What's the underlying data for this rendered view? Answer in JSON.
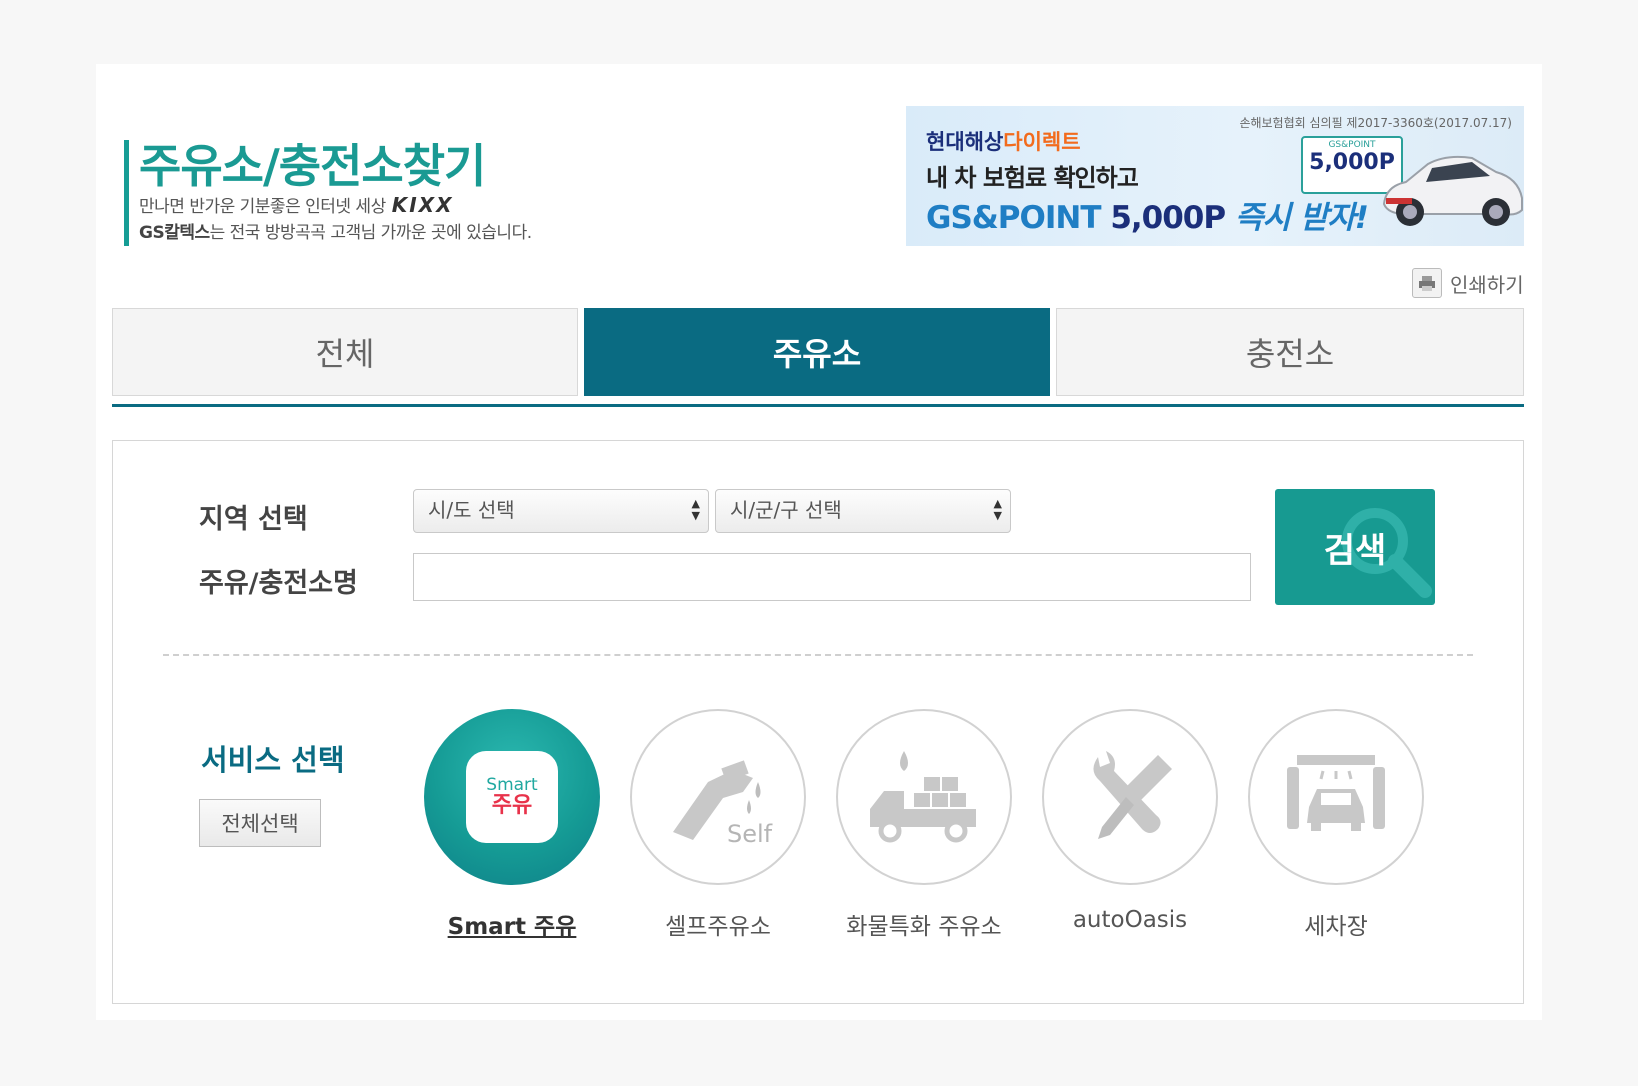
{
  "header": {
    "title": "주유소/충전소찾기",
    "subtitle_1": "만나면 반가운 기분좋은 인터넷 세상",
    "subtitle_brand": "KIXX",
    "subtitle_2_brand": "GS칼텍스",
    "subtitle_2": "는 전국 방방곡곡 고객님 가까운 곳에 있습니다."
  },
  "banner": {
    "notice": "손해보험협회 심의필 제2017-3360호(2017.07.17)",
    "brand": "현대해상",
    "brand_accent": "다이렉트",
    "line2": "내 차 보험료 확인하고",
    "line3_prefix": "GS&POINT",
    "line3_amount": "5,000P",
    "line3_action": "즉시 받자!",
    "card_top": "GS&POINT",
    "card_value": "5,000P"
  },
  "print": {
    "label": "인쇄하기"
  },
  "tabs": [
    {
      "label": "전체",
      "active": false
    },
    {
      "label": "주유소",
      "active": true
    },
    {
      "label": "충전소",
      "active": false
    }
  ],
  "search": {
    "region_label": "지역 선택",
    "sido_select": "시/도 선택",
    "sigungu_select": "시/군/구 선택",
    "name_label": "주유/충전소명",
    "name_value": "",
    "button_label": "검색"
  },
  "services": {
    "label": "서비스 선택",
    "select_all": "전체선택",
    "smart_en": "Smart",
    "smart_ko": "주유",
    "self_text": "Self",
    "items": [
      {
        "label": "Smart 주유",
        "icon": "smart-fuel-app-icon",
        "active": true
      },
      {
        "label": "셀프주유소",
        "icon": "self-fuel-nozzle-icon",
        "active": false
      },
      {
        "label": "화물특화 주유소",
        "icon": "cargo-truck-icon",
        "active": false
      },
      {
        "label": "autoOasis",
        "icon": "wrench-screwdriver-icon",
        "active": false
      },
      {
        "label": "세차장",
        "icon": "car-wash-icon",
        "active": false
      }
    ]
  },
  "colors": {
    "teal": "#179a91",
    "navy_teal": "#0a6b82",
    "title": "#1a9a93"
  }
}
